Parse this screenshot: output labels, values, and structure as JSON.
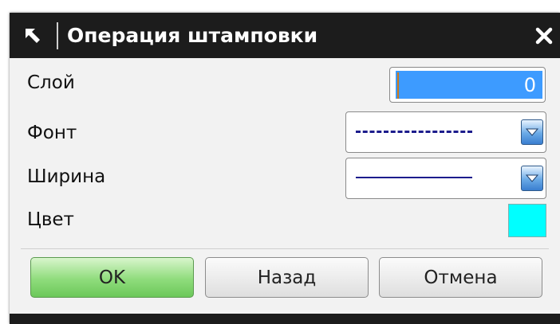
{
  "window": {
    "title": "Операция штамповки",
    "pin_icon": "pin-arrow-icon",
    "close_icon": "close-icon"
  },
  "fields": {
    "layer": {
      "label": "Слой",
      "value": "0"
    },
    "font": {
      "label": "Фонт",
      "selected": "dashed-line"
    },
    "width": {
      "label": "Ширина",
      "selected": "thin-solid-line"
    },
    "color": {
      "label": "Цвет",
      "value": "#00FFFF"
    }
  },
  "buttons": {
    "ok": "OK",
    "back": "Назад",
    "cancel": "Отмена"
  },
  "colors": {
    "titlebar": "#1C1C1C",
    "layer_highlight": "#3D9BFF",
    "ok_button": "#8FDC7C",
    "line_sample": "#1C1C8C"
  }
}
